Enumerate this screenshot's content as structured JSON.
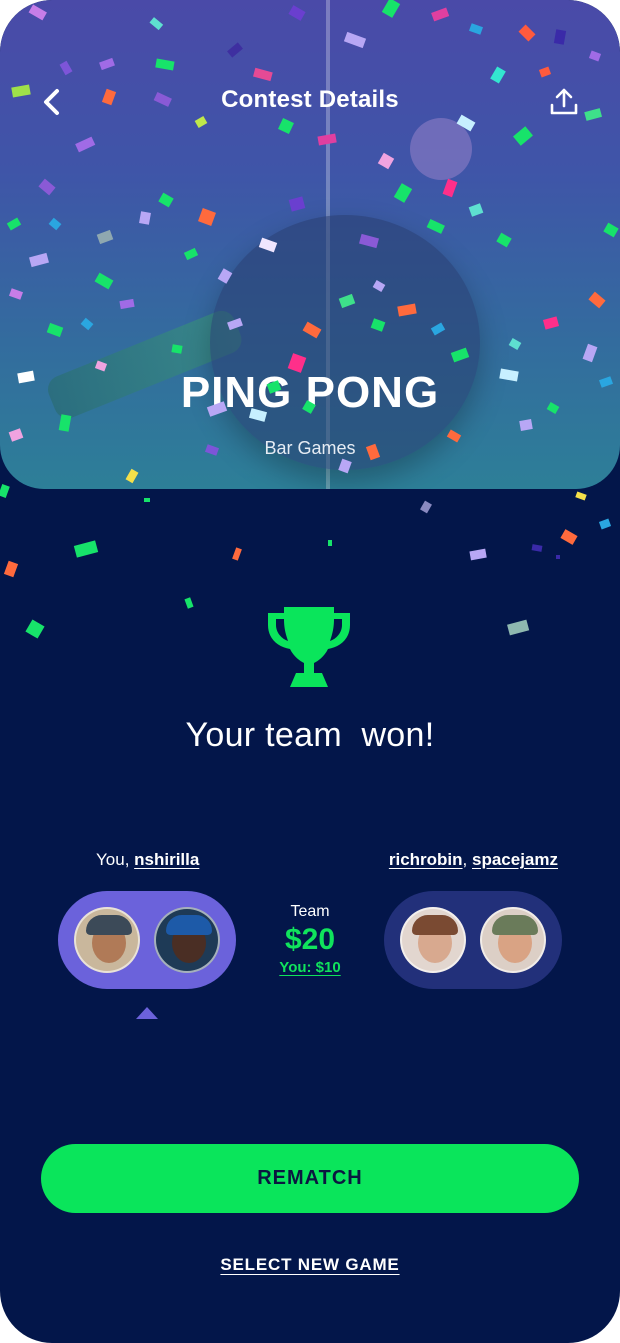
{
  "header": {
    "title": "Contest Details",
    "back_icon": "chevron-left-icon",
    "share_icon": "share-upload-icon"
  },
  "game": {
    "name": "PING PONG",
    "category": "Bar Games"
  },
  "result": {
    "trophy_icon": "trophy-icon",
    "message": "Your team  won!"
  },
  "teams": {
    "left": {
      "prefix": "You, ",
      "partner": "nshirilla",
      "avatars": [
        "avatar-you",
        "avatar-nshirilla"
      ]
    },
    "right": {
      "player1": "richrobin",
      "separator": ", ",
      "player2": "spacejamz",
      "avatars": [
        "avatar-richrobin",
        "avatar-spacejamz"
      ]
    }
  },
  "prize": {
    "label": "Team",
    "amount": "$20",
    "your_share": "You: $10"
  },
  "actions": {
    "rematch": "REMATCH",
    "select_new_game": "SELECT NEW GAME"
  },
  "colors": {
    "background": "#03164a",
    "accent_green": "#0ae55b",
    "your_team": "#6b62db",
    "other_team": "#22307a"
  }
}
